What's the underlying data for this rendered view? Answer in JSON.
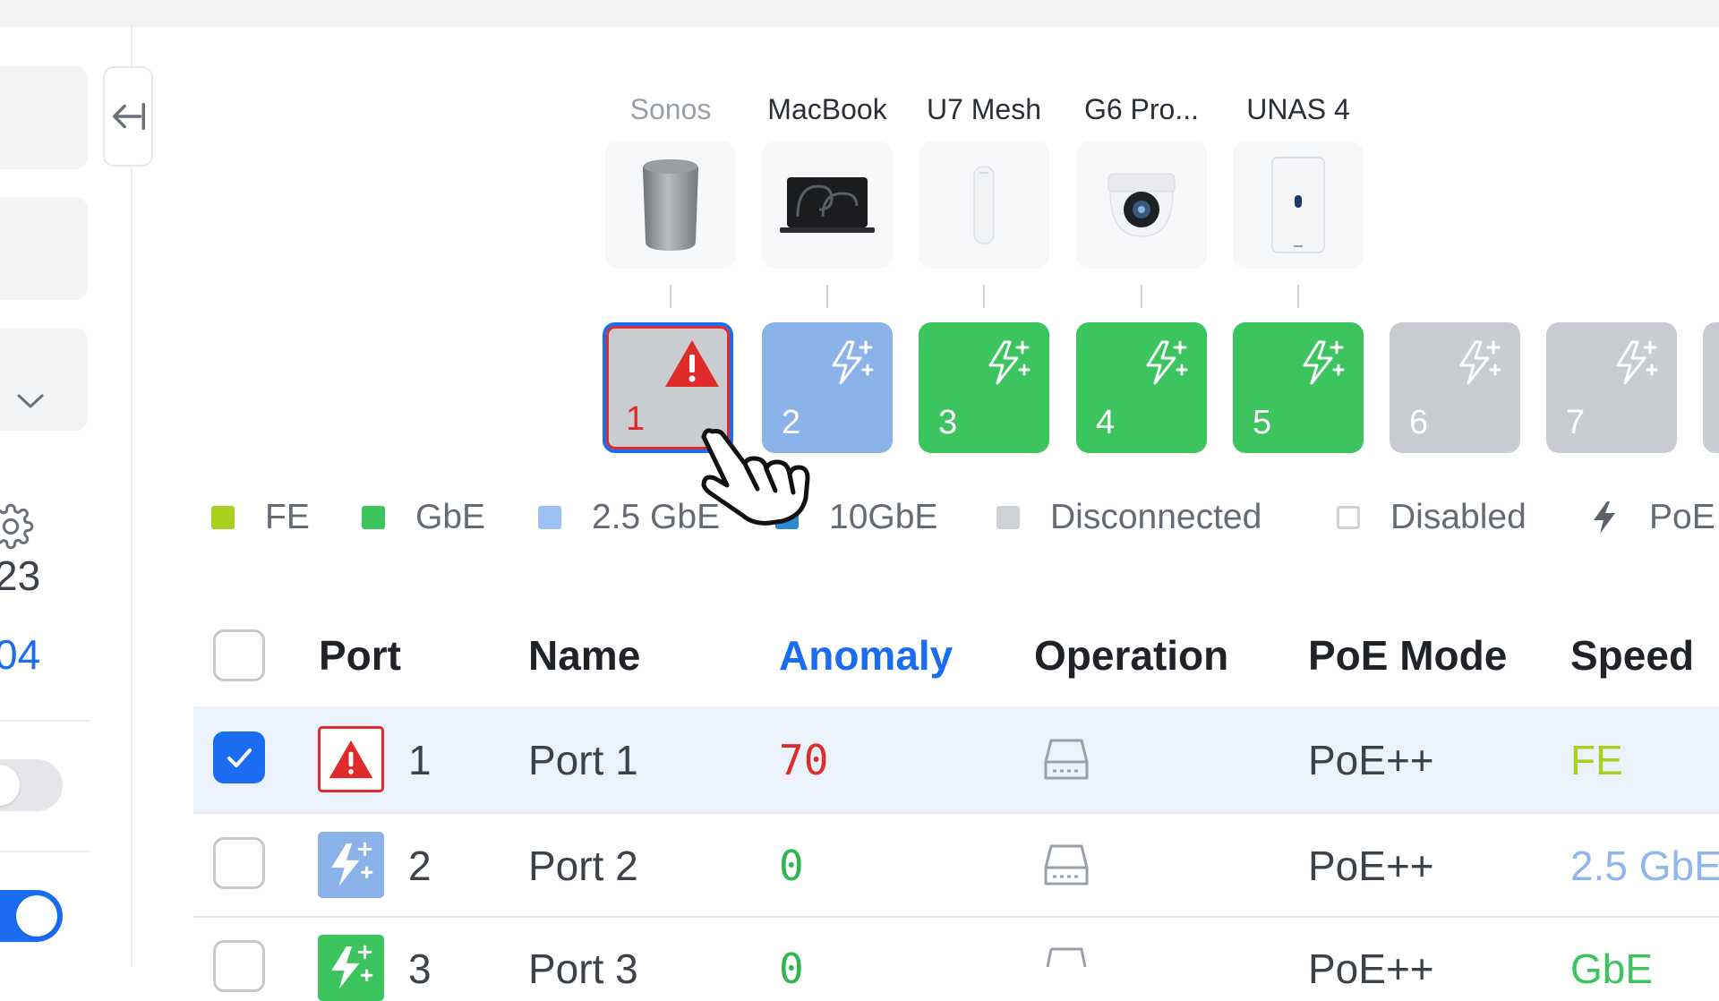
{
  "sidebar": {
    "number_a": "23",
    "number_b": "04"
  },
  "devices": [
    {
      "label": "Sonos",
      "dimmed": true,
      "icon": "sonos-speaker-icon"
    },
    {
      "label": "MacBook",
      "dimmed": false,
      "icon": "macbook-icon"
    },
    {
      "label": "U7 Mesh",
      "dimmed": false,
      "icon": "access-point-icon"
    },
    {
      "label": "G6 Pro...",
      "dimmed": false,
      "icon": "dome-camera-icon"
    },
    {
      "label": "UNAS 4",
      "dimmed": false,
      "icon": "nas-icon"
    }
  ],
  "ports": [
    {
      "number": "1",
      "state": "anomaly",
      "color": "#c9ccd1",
      "icon": "warning-icon"
    },
    {
      "number": "2",
      "state": "2.5 GbE",
      "color": "#8cb2ea",
      "icon": "poe-icon"
    },
    {
      "number": "3",
      "state": "GbE",
      "color": "#3cc45e",
      "icon": "poe-icon"
    },
    {
      "number": "4",
      "state": "GbE",
      "color": "#3cc45e",
      "icon": "poe-icon"
    },
    {
      "number": "5",
      "state": "GbE",
      "color": "#3cc45e",
      "icon": "poe-icon"
    },
    {
      "number": "6",
      "state": "Disconnected",
      "color": "#c9ccd1",
      "icon": "poe-icon"
    },
    {
      "number": "7",
      "state": "Disconnected",
      "color": "#c9ccd1",
      "icon": "poe-icon"
    }
  ],
  "legend": [
    {
      "label": "FE",
      "color": "#a6d11d"
    },
    {
      "label": "GbE",
      "color": "#3cc45e"
    },
    {
      "label": "2.5 GbE",
      "color": "#9cc0f4"
    },
    {
      "label": "10GbE",
      "color": "#2a8ad6"
    },
    {
      "label": "Disconnected",
      "color": "#cfd2d6"
    },
    {
      "label": "Disabled",
      "color": "#ffffff"
    },
    {
      "label": "PoE",
      "icon": "poe-bolt-icon"
    }
  ],
  "table": {
    "headers": {
      "port": "Port",
      "name": "Name",
      "anomaly": "Anomaly",
      "operation": "Operation",
      "poe_mode": "PoE Mode",
      "speed": "Speed"
    },
    "rows": [
      {
        "port": "1",
        "name": "Port 1",
        "anomaly": "70",
        "poe_mode": "PoE++",
        "speed": "FE",
        "selected": true,
        "icon": "warning-icon"
      },
      {
        "port": "2",
        "name": "Port 2",
        "anomaly": "0",
        "poe_mode": "PoE++",
        "speed": "2.5 GbE",
        "selected": false,
        "icon": "poe-icon"
      },
      {
        "port": "3",
        "name": "Port 3",
        "anomaly": "0",
        "poe_mode": "PoE++",
        "speed": "GbE",
        "selected": false,
        "icon": "poe-icon"
      }
    ]
  },
  "colors": {
    "accent": "#1a6cf0",
    "anomaly_red": "#e02b2b",
    "zero_green": "#2fb84f",
    "fe_green": "#a6d11d",
    "speed_blue": "#8fb7ee",
    "gbe_green": "#3cc45e"
  }
}
